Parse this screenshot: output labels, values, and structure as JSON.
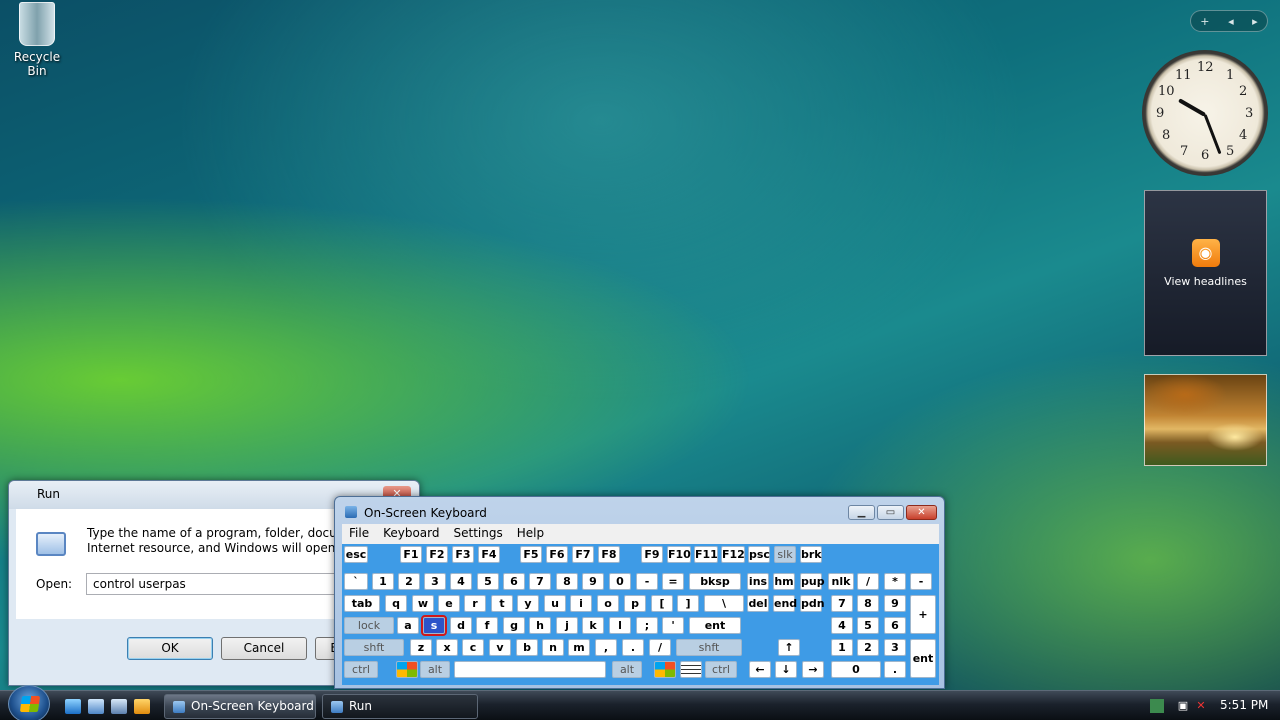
{
  "desktop": {
    "recycle_bin_label": "Recycle Bin"
  },
  "sidebar": {
    "gadget_controls": {
      "add": "+",
      "prev": "◂",
      "next": "▸"
    },
    "clock_numbers": [
      "12",
      "1",
      "2",
      "3",
      "4",
      "5",
      "6",
      "7",
      "8",
      "9",
      "10",
      "11"
    ],
    "headlines_label": "View headlines"
  },
  "run_dialog": {
    "title": "Run",
    "close_glyph": "✕",
    "description": "Type the name of a program, folder, document, or Internet resource, and Windows will open it for you.",
    "open_label": "Open:",
    "open_value": "control userpas",
    "ok_label": "OK",
    "cancel_label": "Cancel",
    "browse_label": "Browse..."
  },
  "osk": {
    "title": "On-Screen Keyboard",
    "menu": [
      "File",
      "Keyboard",
      "Settings",
      "Help"
    ],
    "window_buttons": {
      "minimize": "▁",
      "maximize": "▭",
      "close": "✕"
    },
    "pressed_key": "s",
    "row1": [
      "esc",
      "F1",
      "F2",
      "F3",
      "F4",
      "F5",
      "F6",
      "F7",
      "F8",
      "F9",
      "F10",
      "F11",
      "F12",
      "psc",
      "slk",
      "brk"
    ],
    "row2": [
      "`",
      "1",
      "2",
      "3",
      "4",
      "5",
      "6",
      "7",
      "8",
      "9",
      "0",
      "-",
      "=",
      "bksp",
      "ins",
      "hm",
      "pup",
      "nlk",
      "/",
      "*",
      "-"
    ],
    "row3": [
      "tab",
      "q",
      "w",
      "e",
      "r",
      "t",
      "y",
      "u",
      "i",
      "o",
      "p",
      "[",
      "]",
      "\\",
      "del",
      "end",
      "pdn",
      "7",
      "8",
      "9",
      "+"
    ],
    "row4": [
      "lock",
      "a",
      "s",
      "d",
      "f",
      "g",
      "h",
      "j",
      "k",
      "l",
      ";",
      "'",
      "ent",
      "4",
      "5",
      "6"
    ],
    "row5": [
      "shft",
      "z",
      "x",
      "c",
      "v",
      "b",
      "n",
      "m",
      ",",
      ".",
      "/",
      "shft",
      "↑",
      "1",
      "2",
      "3",
      "ent"
    ],
    "row6": [
      "ctrl",
      "alt",
      "alt",
      "ctrl",
      "←",
      "↓",
      "→",
      "0",
      "."
    ]
  },
  "taskbar": {
    "tasks": [
      {
        "label": "On-Screen Keyboard"
      },
      {
        "label": "Run"
      }
    ],
    "clock": "5:51 PM"
  }
}
